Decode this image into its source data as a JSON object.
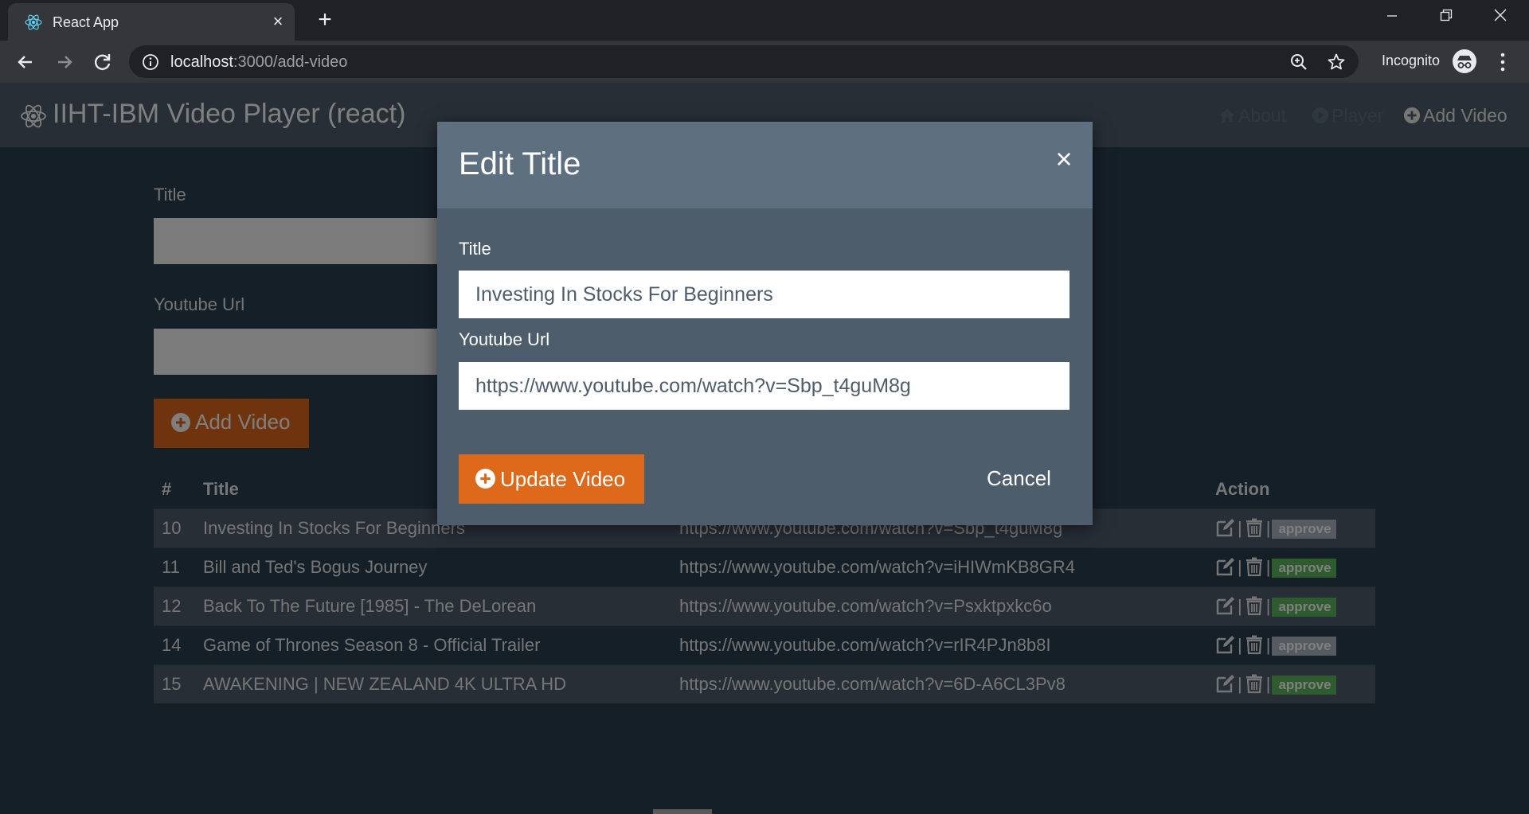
{
  "browser": {
    "tab_title": "React App",
    "url_host": "localhost",
    "url_path": ":3000/add-video",
    "incognito_label": "Incognito"
  },
  "app": {
    "brand": "IIHT-IBM Video Player (react)",
    "nav": {
      "about": "About",
      "player": "Player",
      "add_video": "Add Video"
    }
  },
  "form": {
    "title_label": "Title",
    "title_value": "",
    "url_label": "Youtube Url",
    "url_value": "",
    "submit_label": "Add Video"
  },
  "table": {
    "headers": {
      "num": "#",
      "title": "Title",
      "url": "",
      "action": "Action"
    },
    "rows": [
      {
        "id": "10",
        "title": "Investing In Stocks For Beginners",
        "url": "https://www.youtube.com/watch?v=Sbp_t4guM8g",
        "badge": "approve",
        "approved": false
      },
      {
        "id": "11",
        "title": "Bill and Ted's Bogus Journey",
        "url": "https://www.youtube.com/watch?v=iHIWmKB8GR4",
        "badge": "approve",
        "approved": true
      },
      {
        "id": "12",
        "title": "Back To The Future [1985] - The DeLorean",
        "url": "https://www.youtube.com/watch?v=Psxktpxkc6o",
        "badge": "approve",
        "approved": true
      },
      {
        "id": "14",
        "title": "Game of Thrones Season 8 - Official Trailer",
        "url": "https://www.youtube.com/watch?v=rIR4PJn8b8I",
        "badge": "approve",
        "approved": false
      },
      {
        "id": "15",
        "title": "AWAKENING | NEW ZEALAND 4K ULTRA HD",
        "url": "https://www.youtube.com/watch?v=6D-A6CL3Pv8",
        "badge": "approve",
        "approved": true
      }
    ]
  },
  "modal": {
    "title": "Edit Title",
    "close_glyph": "×",
    "title_label": "Title",
    "title_value": "Investing In Stocks For Beginners",
    "url_label": "Youtube Url",
    "url_value": "https://www.youtube.com/watch?v=Sbp_t4guM8g",
    "update_label": "Update Video",
    "cancel_label": "Cancel"
  },
  "colors": {
    "accent": "#df691a",
    "navbar": "#4e5d6c",
    "page_bg": "#2b3e50",
    "badge_approved": "#5cb85c",
    "badge_pending": "#abb6c2"
  }
}
